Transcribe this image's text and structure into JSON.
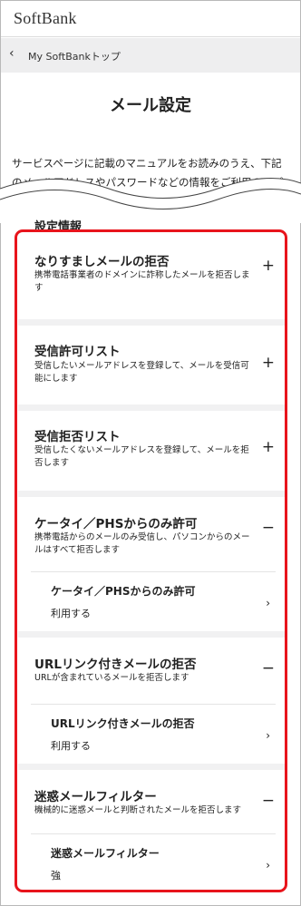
{
  "brand": {
    "logo": "SoftBank"
  },
  "breadcrumb": {
    "label": "My SoftBankトップ"
  },
  "page": {
    "title": "メール設定",
    "intro": "サービスページに記載のマニュアルをお読みのうえ、下記のメールアドレスやパスワードなどの情報をご利用のアプリケーション",
    "section_title": "設定情報"
  },
  "settings": [
    {
      "title": "なりすましメールの拒否",
      "desc": "携帯電話事業者のドメインに詐称したメールを拒否します",
      "control": "+"
    },
    {
      "title": "受信許可リスト",
      "desc": "受信したいメールアドレスを登録して、メールを受信可能にします",
      "control": "+"
    },
    {
      "title": "受信拒否リスト",
      "desc": "受信したくないメールアドレスを登録して、メールを拒否します",
      "control": "+"
    },
    {
      "title": "ケータイ／PHSからのみ許可",
      "desc": "携帯電話からのメールのみ受信し、パソコンからのメールはすべて拒否します",
      "control": "−",
      "sub": {
        "title": "ケータイ／PHSからのみ許可",
        "value": "利用する"
      }
    },
    {
      "title": "URLリンク付きメールの拒否",
      "desc": "URLが含まれているメールを拒否します",
      "control": "−",
      "sub": {
        "title": "URLリンク付きメールの拒否",
        "value": "利用する"
      }
    },
    {
      "title": "迷惑メールフィルター",
      "desc": "機械的に迷惑メールと判断されたメールを拒否します",
      "control": "−",
      "sub": {
        "title": "迷惑メールフィルター",
        "value": "強"
      }
    }
  ],
  "colors": {
    "highlight_border": "#e8141c",
    "breadcrumb_bg": "#eeeeef",
    "content_bg": "#f1f1f2"
  },
  "icons": {
    "back": "chevron-left-icon",
    "expand": "plus-icon",
    "collapse": "minus-icon",
    "next": "chevron-right-icon"
  }
}
